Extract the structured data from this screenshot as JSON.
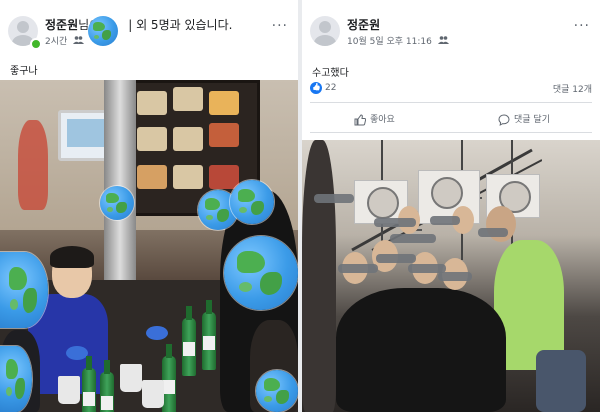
{
  "left_post": {
    "author": "정준원",
    "title_suffix_visible": "님이",
    "title_tail": "| 외 5명과 있습니다.",
    "time": "2시간",
    "more": "...",
    "text": "좋구나"
  },
  "right_post": {
    "author": "정준원",
    "time": "10월 5일 오후 11:16",
    "more": "...",
    "text": "수고했다",
    "like_count": "22",
    "comment_count": "댓글 12개",
    "actions": {
      "like": "좋아요",
      "comment": "댓글 달기"
    }
  },
  "colors": {
    "facebook_blue": "#1877f2",
    "online_green": "#42b72a",
    "meta_gray": "#606770"
  },
  "icons": [
    "friends-icon",
    "like-icon",
    "comment-icon",
    "globe-sticker",
    "more-icon"
  ]
}
